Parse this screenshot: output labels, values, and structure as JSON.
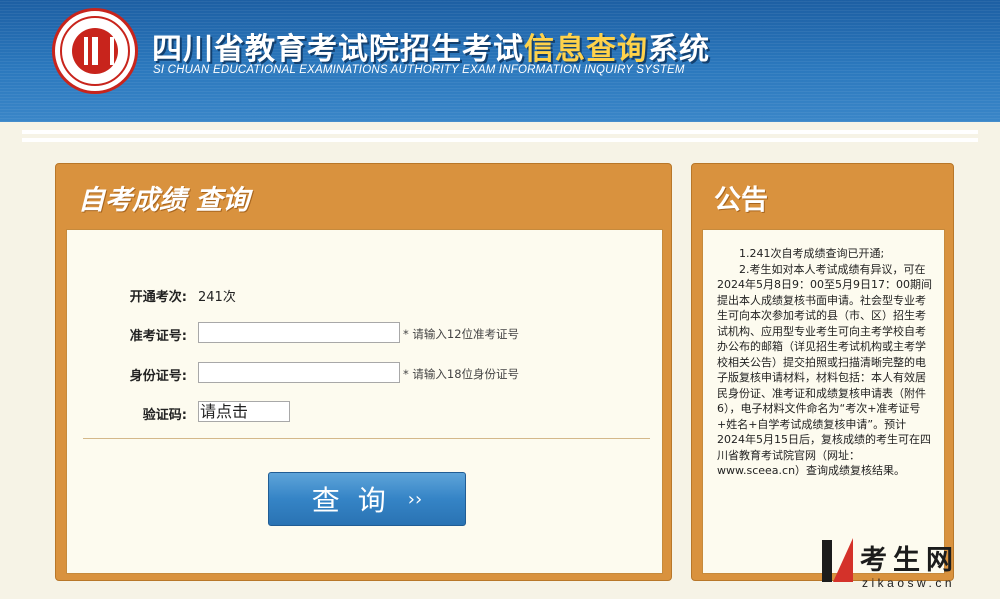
{
  "header": {
    "title_part1": "四川省教育考试院招生考试",
    "title_highlight": "信息查询",
    "title_part2": "系统",
    "title_en": "SI CHUAN EDUCATIONAL EXAMINATIONS AUTHORITY EXAM INFORMATION INQUIRY SYSTEM"
  },
  "form": {
    "title": "自考成绩 查询",
    "session_label": "开通考次:",
    "session_value": "241次",
    "ticket_label": "准考证号:",
    "ticket_value": "",
    "ticket_hint": "* 请输入12位准考证号",
    "id_label": "身份证号:",
    "id_value": "",
    "id_hint": "* 请输入18位身份证号",
    "captcha_label": "验证码:",
    "captcha_text": "请点击",
    "query_label": "查询",
    "query_arrow": "››"
  },
  "notice": {
    "title": "公告",
    "lines": [
      "1.241次自考成绩查询已开通;",
      "2.考生如对本人考试成绩有异议，可在2024年5月8日9：00至5月9日17：00期间提出本人成绩复核书面申请。社会型专业考生可向本次参加考试的县（市、区）招生考试机构、应用型专业考生可向主考学校自考办公布的邮箱（详见招生考试机构或主考学校相关公告）提交拍照或扫描清晰完整的电子版复核申请材料，材料包括：本人有效居民身份证、准考证和成绩复核申请表（附件6），电子材料文件命名为“考次+准考证号+姓名+自学考试成绩复核申请”。预计2024年5月15日后，复核成绩的考生可在四川省教育考试院官网（网址：www.sceea.cn）查询成绩复核结果。"
    ]
  },
  "watermark": {
    "text": "考生网",
    "url": "zikaosw.cn"
  }
}
